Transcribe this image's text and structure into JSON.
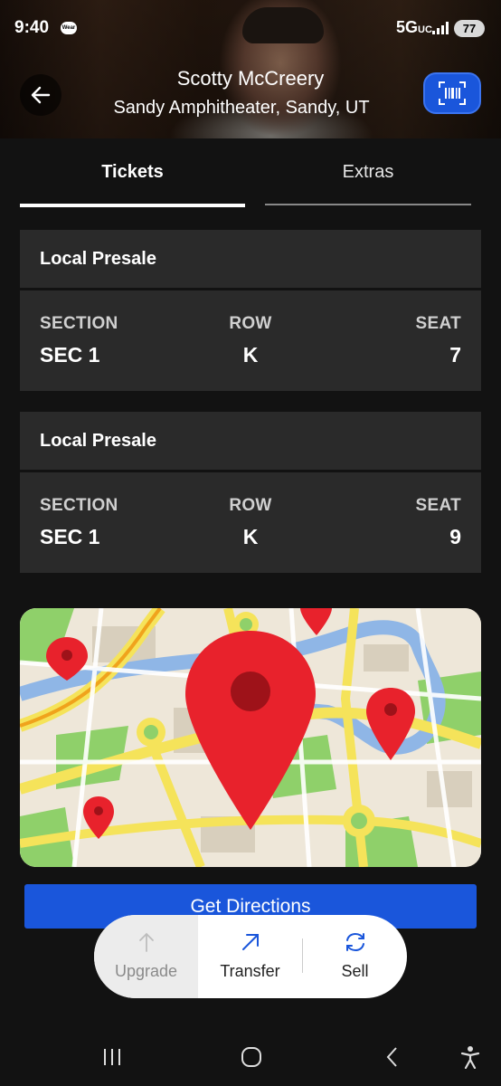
{
  "status_bar": {
    "time": "9:40",
    "wear_badge": "Wear",
    "network": "5G",
    "network_sub": "UC",
    "battery": "77"
  },
  "header": {
    "artist": "Scotty McCreery",
    "venue": "Sandy Amphitheater, Sandy, UT"
  },
  "tabs": [
    {
      "label": "Tickets",
      "active": true
    },
    {
      "label": "Extras",
      "active": false
    }
  ],
  "tickets": [
    {
      "type": "Local Presale",
      "section_label": "SECTION",
      "row_label": "ROW",
      "seat_label": "SEAT",
      "section": "SEC 1",
      "row": "K",
      "seat": "7"
    },
    {
      "type": "Local Presale",
      "section_label": "SECTION",
      "row_label": "ROW",
      "seat_label": "SEAT",
      "section": "SEC 1",
      "row": "K",
      "seat": "9"
    }
  ],
  "directions_button": "Get Directions",
  "actions": {
    "upgrade": "Upgrade",
    "transfer": "Transfer",
    "sell": "Sell"
  },
  "colors": {
    "accent": "#1a56db",
    "background": "#121212",
    "card": "#2a2a2a",
    "pin": "#e8222c"
  },
  "icons": {
    "back": "arrow-left-icon",
    "scan": "barcode-icon",
    "upgrade": "arrow-up-icon",
    "transfer": "arrow-up-right-icon",
    "sell": "refresh-icon"
  }
}
